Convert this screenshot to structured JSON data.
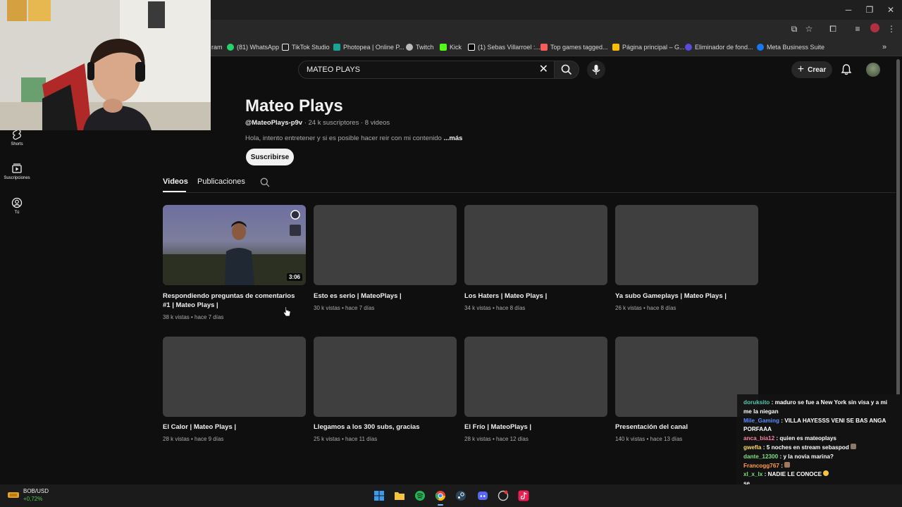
{
  "browser": {
    "bookmarks": [
      {
        "label": "ram",
        "color": "#c13584"
      },
      {
        "label": "(81) WhatsApp",
        "color": "#25d366"
      },
      {
        "label": "TikTok Studio",
        "color": "#eeeeee"
      },
      {
        "label": "Photopea | Online P...",
        "color": "#18a497"
      },
      {
        "label": "Twitch",
        "color": "#bbbbbb"
      },
      {
        "label": "Kick",
        "color": "#53fc18"
      },
      {
        "label": "(1) Sebas Villarroel :...",
        "color": "#ffffff"
      },
      {
        "label": "Top games tagged...",
        "color": "#fa5c5c"
      },
      {
        "label": "Página principal – G...",
        "color": "#fbbc04"
      },
      {
        "label": "Eliminador de fond...",
        "color": "#5b4bdb"
      },
      {
        "label": "Meta Business Suite",
        "color": "#1877f2"
      }
    ]
  },
  "header": {
    "search_value": "MATEO PLAYS",
    "create_label": "Crear"
  },
  "sidebar": {
    "items": [
      {
        "label": "Shorts",
        "icon": "shorts-icon"
      },
      {
        "label": "Suscripciones",
        "icon": "subscriptions-icon"
      },
      {
        "label": "Tú",
        "icon": "you-icon"
      }
    ]
  },
  "channel": {
    "name": "Mateo Plays",
    "handle": "@MateoPlays-p9v",
    "stats": " · 24 k suscriptores · 8 videos",
    "description": "Hola, intento entretener y si es posible hacer reir con mi contenido ",
    "more_label": "...más",
    "subscribe_label": "Suscribirse",
    "tabs": [
      "Videos",
      "Publicaciones"
    ]
  },
  "videos": [
    {
      "title": "Respondiendo preguntas de comentarios #1 | Mateo Plays |",
      "meta": "38 k vistas • hace 7 días",
      "duration": "3:06"
    },
    {
      "title": "Esto es serio | MateoPlays |",
      "meta": "30 k vistas • hace 7 días"
    },
    {
      "title": "Los Haters | Mateo Plays |",
      "meta": "34 k vistas • hace 8 días"
    },
    {
      "title": "Ya subo Gameplays | Mateo Plays |",
      "meta": "26 k vistas • hace 8 días"
    },
    {
      "title": "El Calor | Mateo Plays |",
      "meta": "28 k vistas • hace 9 días"
    },
    {
      "title": "Llegamos a los 300 subs, gracias",
      "meta": "25 k vistas • hace 11 días"
    },
    {
      "title": "El Frío | MateoPlays |",
      "meta": "28 k vistas • hace 12 días"
    },
    {
      "title": "Presentación del canal",
      "meta": "140 k vistas • hace 13 días"
    }
  ],
  "chat": [
    {
      "user": "doruksito",
      "color": "#4ec9b0",
      "msg": " : maduro se fue a New York sin visa y a mi me la niegan"
    },
    {
      "user": "Mile_Gaming",
      "color": "#5b8dff",
      "msg": " : VILLA HAYESSS VENI SE BAS ANGA PORFAAA"
    },
    {
      "user": "anca_bia12",
      "color": "#ff7fa0",
      "msg": " : quien es mateoplays"
    },
    {
      "user": "gwefla",
      "color": "#ffd966",
      "msg": " : 5 noches en stream sebaspod"
    },
    {
      "user": "dante_12300",
      "color": "#7ee07e",
      "msg": " : y la novia marina?"
    },
    {
      "user": "Francogg767",
      "color": "#ff9f43",
      "msg": " :"
    },
    {
      "user": "xl_x_lx",
      "color": "#7ee07e",
      "msg": " : NADIE LE CONOCE"
    },
    {
      "user": "",
      "color": "#ffffff",
      "msg": "se"
    }
  ],
  "taskbar": {
    "ticker_label": "BOB/USD",
    "ticker_change": "+0,72%",
    "apps": [
      {
        "name": "windows-start-icon",
        "color": "#3a9bf0"
      },
      {
        "name": "file-explorer-icon",
        "color": "#f5c342"
      },
      {
        "name": "spotify-icon",
        "color": "#1db954"
      },
      {
        "name": "chrome-icon",
        "color": "#ea4335"
      },
      {
        "name": "steam-icon",
        "color": "#2a475e"
      },
      {
        "name": "discord-icon",
        "color": "#5865f2"
      },
      {
        "name": "app-icon",
        "color": "#cccccc"
      },
      {
        "name": "tiktok-icon",
        "color": "#ee1d52"
      }
    ]
  }
}
